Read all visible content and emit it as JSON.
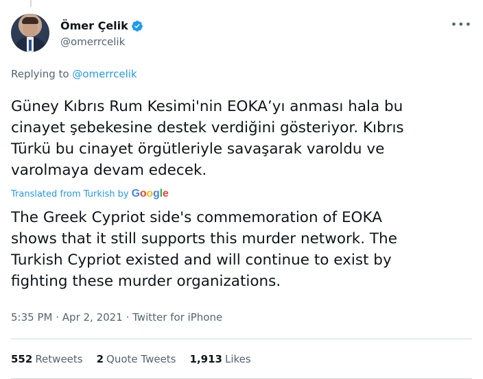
{
  "author": {
    "name": "Ömer Çelik",
    "handle": "@omerrcelik",
    "verified": true,
    "avatar_icon": "profile-photo-icon"
  },
  "more_label": "•••",
  "reply": {
    "prefix": "Replying to",
    "mention": "@omerrcelik"
  },
  "tweet": {
    "text": "Güney Kıbrıs Rum Kesimi'nin EOKA’yı anması hala bu\ncinayet şebekesine destek verdiğini gösteriyor. Kıbrıs\nTürkü bu cinayet örgütleriyle savaşarak varoldu ve\nvarolmaya devam edecek.",
    "translated_prefix": "Translated from Turkish by",
    "translator": "Google",
    "translation": "The Greek Cypriot side's commemoration of EOKA\nshows that it still supports this murder network. The\nTurkish Cypriot existed and will continue to exist by\nfighting these murder organizations."
  },
  "meta": {
    "time": "5:35 PM",
    "date": "Apr 2, 2021",
    "source": "Twitter for iPhone",
    "separator": "·"
  },
  "stats": {
    "retweets_count": "552",
    "retweets_label": "Retweets",
    "quotes_count": "2",
    "quotes_label": "Quote Tweets",
    "likes_count": "1,913",
    "likes_label": "Likes"
  },
  "colors": {
    "accent": "#1d9bf0",
    "secondary_text": "#536471",
    "border": "#cfd9de"
  }
}
